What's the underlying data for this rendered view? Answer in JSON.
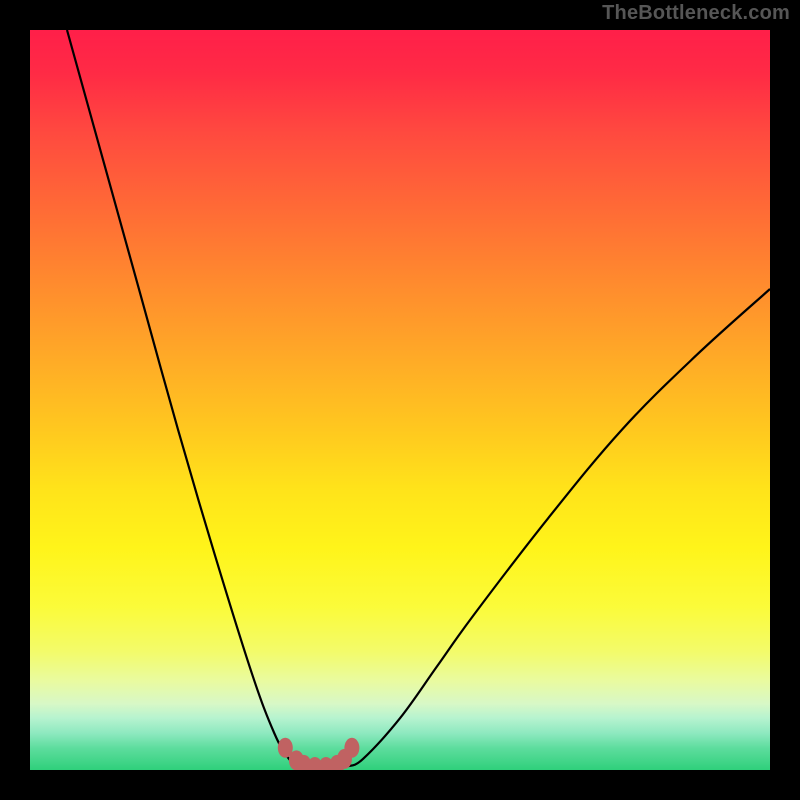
{
  "attribution": "TheBottleneck.com",
  "chart_data": {
    "type": "line",
    "title": "",
    "xlabel": "",
    "ylabel": "",
    "xlim": [
      0,
      100
    ],
    "ylim": [
      0,
      100
    ],
    "series": [
      {
        "name": "left-curve",
        "x": [
          5,
          10,
          15,
          20,
          25,
          30,
          33,
          35,
          36.5
        ],
        "values": [
          100,
          82,
          64,
          46,
          29,
          13,
          5,
          1.5,
          0.5
        ]
      },
      {
        "name": "right-curve",
        "x": [
          43,
          45,
          50,
          55,
          60,
          70,
          80,
          90,
          100
        ],
        "values": [
          0.5,
          1.5,
          7,
          14,
          21,
          34,
          46,
          56,
          65
        ]
      },
      {
        "name": "dip-markers",
        "x": [
          34.5,
          36.0,
          37.0,
          38.5,
          40.0,
          41.5,
          42.5,
          43.5
        ],
        "values": [
          3.0,
          1.3,
          0.7,
          0.4,
          0.4,
          0.7,
          1.5,
          3.0
        ]
      }
    ],
    "colors": {
      "curve": "#000000",
      "marker": "#c06262"
    }
  }
}
